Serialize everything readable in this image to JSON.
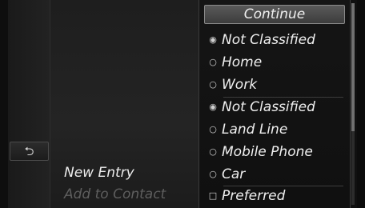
{
  "back_button": {
    "icon": "back-arrow-icon",
    "glyph": "⮌"
  },
  "left_menu": {
    "new_entry": "New Entry",
    "add_to_contact": "Add to Contact"
  },
  "menu": {
    "continue": "Continue",
    "items": [
      {
        "label": "Not Classified",
        "mark": "◉",
        "icon": "radio-selected-icon"
      },
      {
        "label": "Home",
        "mark": "○",
        "icon": "radio-icon"
      },
      {
        "label": "Work",
        "mark": "○",
        "icon": "radio-icon"
      },
      {
        "label": "Not Classified",
        "mark": "◉",
        "icon": "radio-selected-icon"
      },
      {
        "label": "Land Line",
        "mark": "○",
        "icon": "radio-icon"
      },
      {
        "label": "Mobile Phone",
        "mark": "○",
        "icon": "radio-icon"
      },
      {
        "label": "Car",
        "mark": "○",
        "icon": "radio-icon"
      },
      {
        "label": "Preferred",
        "mark": "□",
        "icon": "checkbox-icon"
      }
    ]
  }
}
